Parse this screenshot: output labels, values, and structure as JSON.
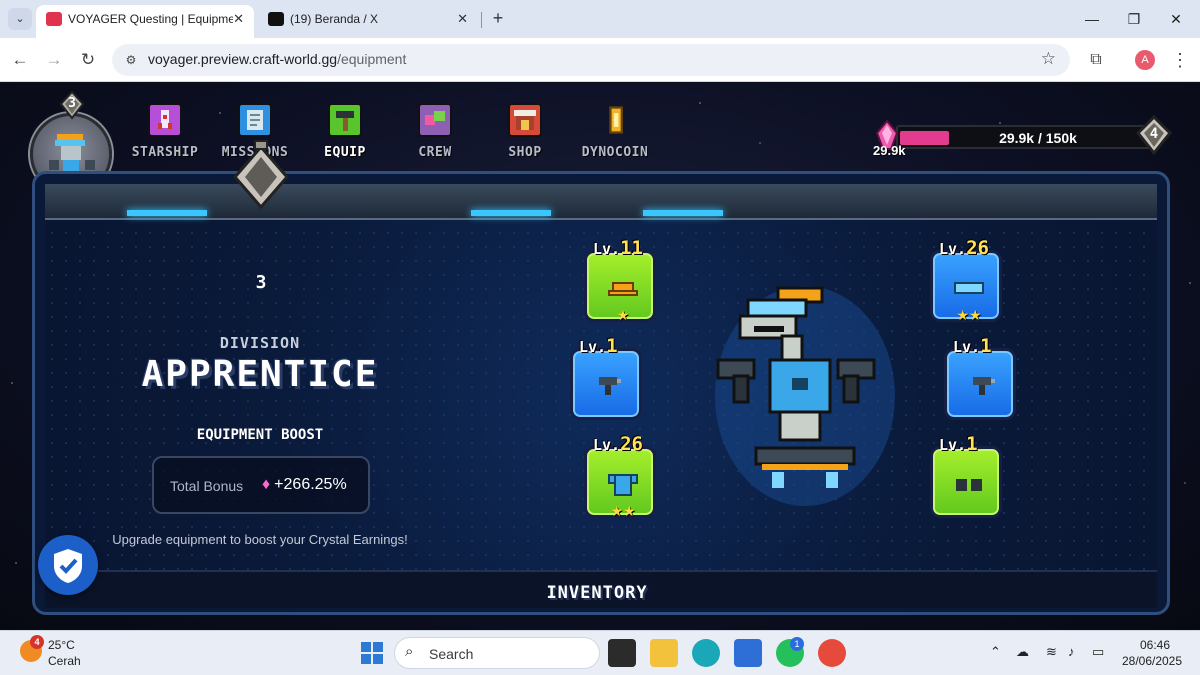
{
  "browser": {
    "tabs": [
      {
        "title": "VOYAGER Questing | Equipment",
        "active": true
      },
      {
        "title": "(19) Beranda / X",
        "active": false
      }
    ],
    "tab_close": "✕",
    "new_tab": "+",
    "url_host": "voyager.preview.craft-world.gg",
    "url_path": "/equipment",
    "profile_initial": "A"
  },
  "game": {
    "player_level": "3",
    "nav": [
      {
        "label": "STARSHIP",
        "icon": "rocket-icon",
        "color": "#b74ed8"
      },
      {
        "label": "MISSIONS",
        "icon": "scroll-icon",
        "color": "#2f8fe0"
      },
      {
        "label": "EQUIP",
        "icon": "hammer-icon",
        "color": "#58c52c"
      },
      {
        "label": "CREW",
        "icon": "crew-icon",
        "color": "#8e5fb3"
      },
      {
        "label": "SHOP",
        "icon": "shop-icon",
        "color": "#d74a3a"
      },
      {
        "label": "DYNOCOIN",
        "icon": "coin-icon",
        "color": "#f0b52a"
      }
    ],
    "active_nav": "EQUIP",
    "crystals": {
      "current": "29.9k",
      "progress_text": "29.9k / 150k",
      "progress_fraction": 0.199,
      "next_level": "4"
    },
    "division": {
      "level": "3",
      "label": "DIVISION",
      "name": "APPRENTICE"
    },
    "boost": {
      "title": "EQUIPMENT BOOST",
      "label": "Total Bonus",
      "value": "+266.25%"
    },
    "hint": "Upgrade equipment to boost your Crystal Earnings!",
    "slots": [
      {
        "name": "helmet",
        "lv_prefix": "Lv.",
        "level": "11",
        "rarity": "green",
        "stars": "★"
      },
      {
        "name": "left-hand",
        "lv_prefix": "Lv.",
        "level": "1",
        "rarity": "blue",
        "stars": ""
      },
      {
        "name": "body",
        "lv_prefix": "Lv.",
        "level": "26",
        "rarity": "green",
        "stars": "★★"
      },
      {
        "name": "goggles",
        "lv_prefix": "Lv.",
        "level": "26",
        "rarity": "blue",
        "stars": "★★"
      },
      {
        "name": "right-hand",
        "lv_prefix": "Lv.",
        "level": "1",
        "rarity": "blue",
        "stars": ""
      },
      {
        "name": "feet",
        "lv_prefix": "Lv.",
        "level": "1",
        "rarity": "green",
        "stars": ""
      }
    ],
    "inventory_label": "INVENTORY"
  },
  "taskbar": {
    "weather_badge": "4",
    "temperature": "25°C",
    "weather": "Cerah",
    "search_placeholder": "Search",
    "whatsapp_badge": "1",
    "time": "06:46",
    "date": "28/06/2025"
  }
}
